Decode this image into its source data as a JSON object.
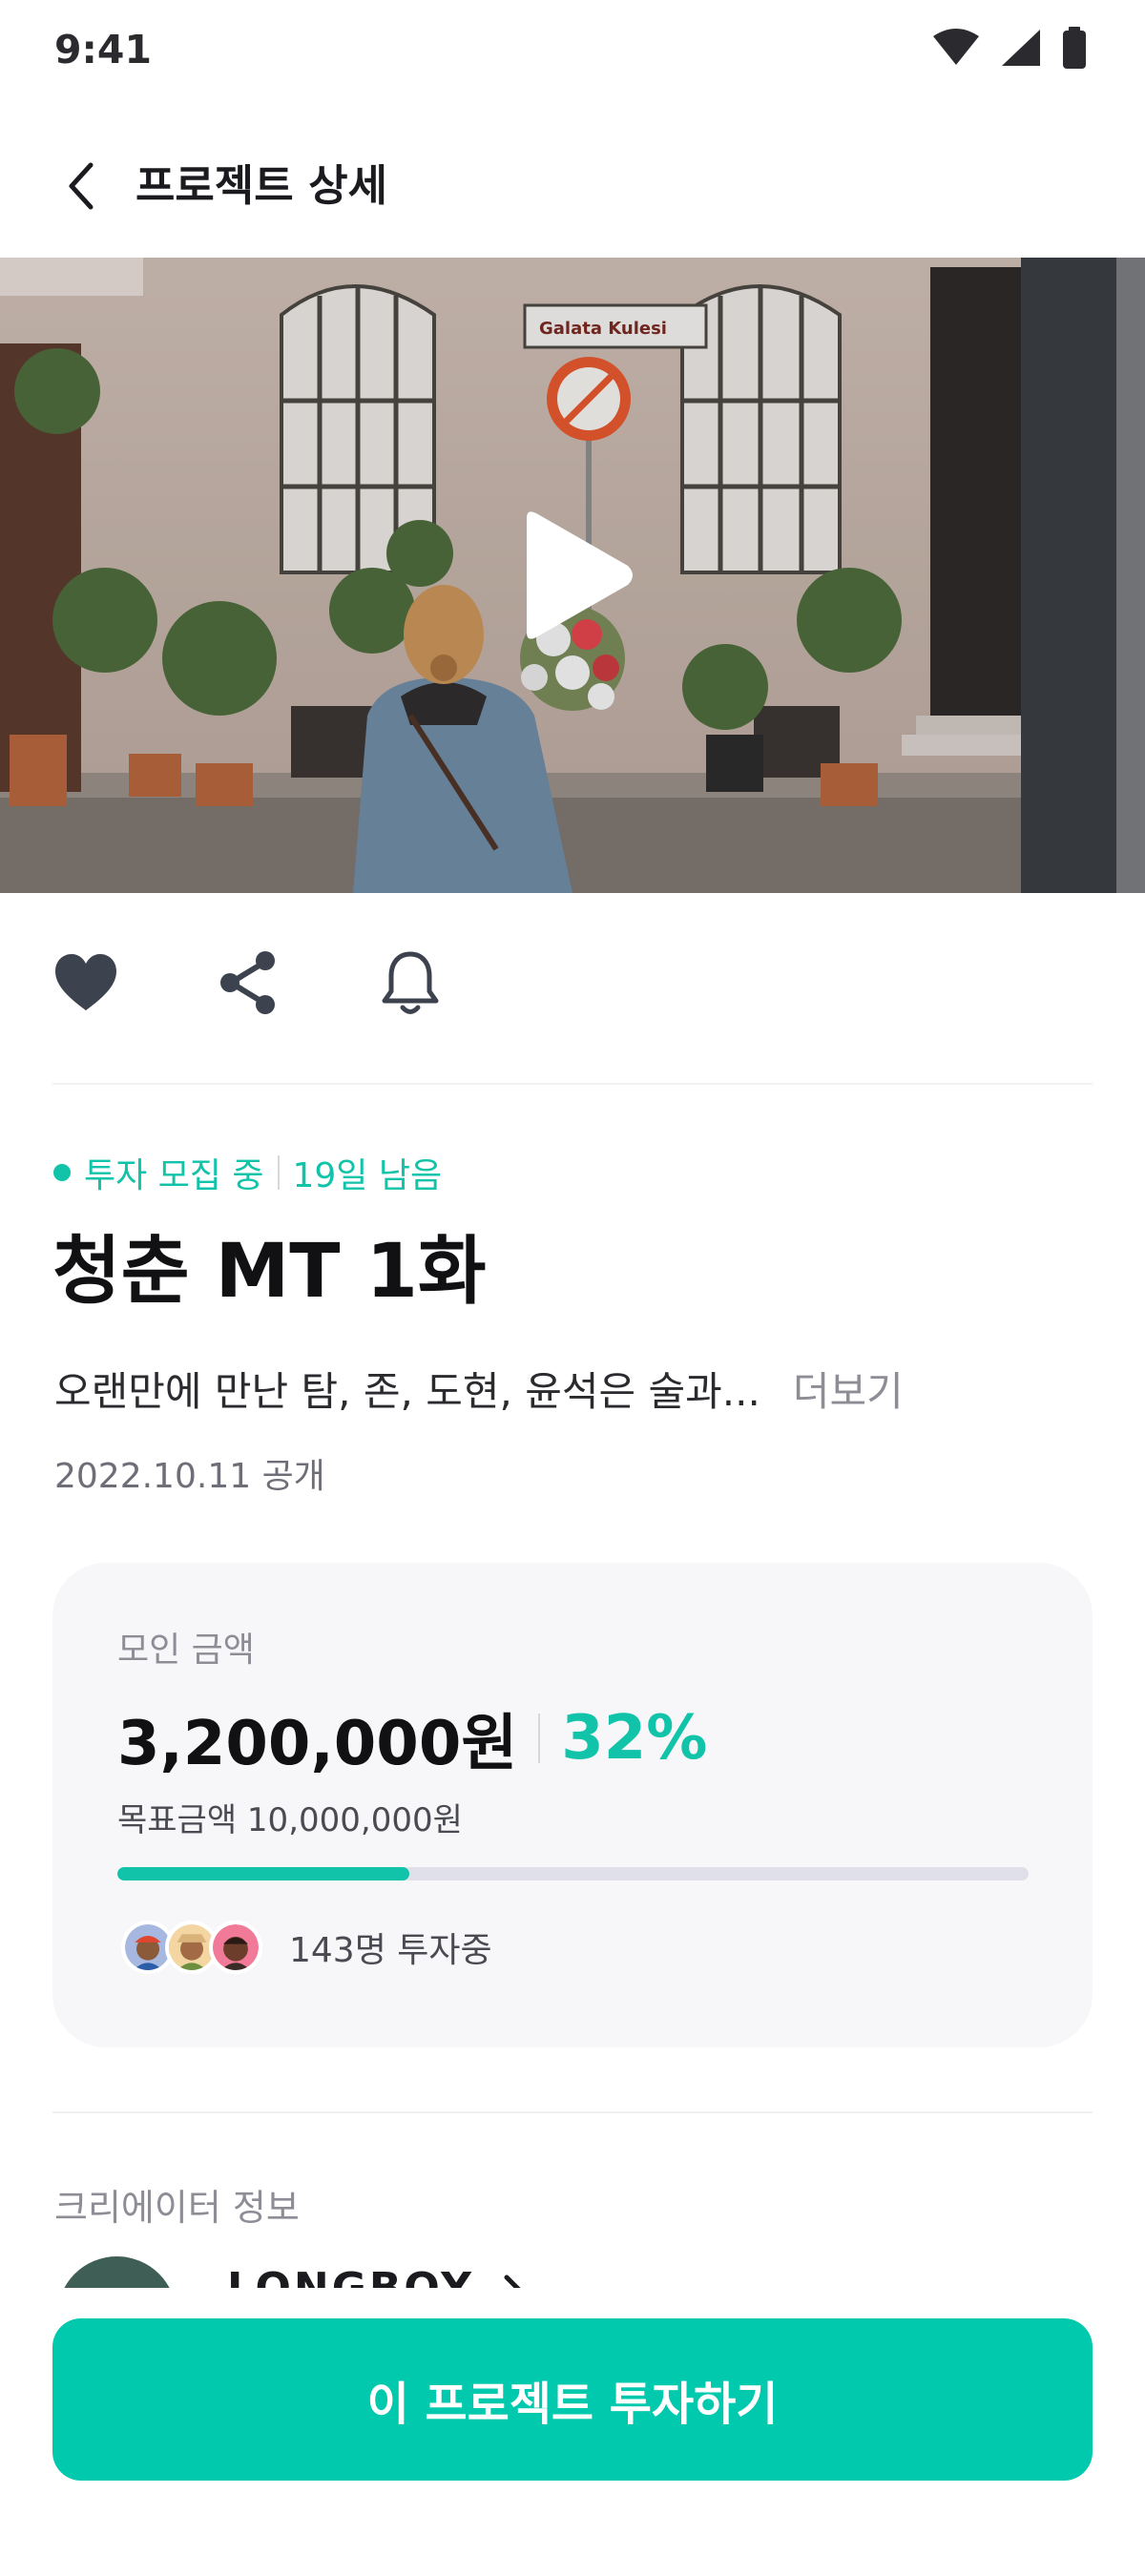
{
  "status_bar": {
    "time": "9:41",
    "icons": [
      "wifi-icon",
      "signal-icon",
      "battery-icon"
    ]
  },
  "header": {
    "back_icon": "chevron-left-icon",
    "title": "프로젝트 상세"
  },
  "video": {
    "play_icon": "play-icon",
    "sign_text": "Galata Kulesi"
  },
  "actions": [
    {
      "icon": "heart-icon"
    },
    {
      "icon": "share-icon"
    },
    {
      "icon": "bell-icon"
    }
  ],
  "project": {
    "status": "투자 모집 중",
    "remaining": "19일 남음",
    "title": "청춘 MT 1화",
    "description": "오랜만에 만난 탐, 존, 도현, 윤석은 술과...",
    "more": "더보기",
    "release_date": "2022.10.11 공개"
  },
  "funding": {
    "label": "모인 금액",
    "amount": "3,200,000원",
    "percent_text": "32%",
    "progress": 0.32,
    "target": "목표금액 10,000,000원",
    "investors_text": "143명 투자중"
  },
  "creator": {
    "label": "크리에이터 정보",
    "name": "LONGBOY"
  },
  "cta": {
    "label": "이 프로젝트 투자하기"
  },
  "colors": {
    "accent": "#00c9ae",
    "accent_text": "#11c3a9",
    "card_bg": "#f7f7f9",
    "progress_track": "#e0e0ea"
  }
}
